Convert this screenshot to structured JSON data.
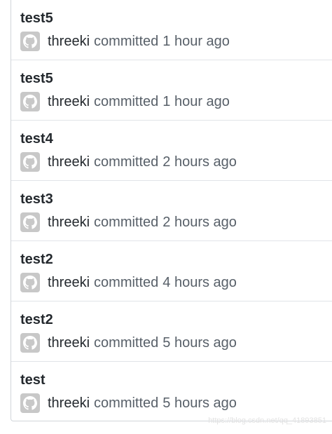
{
  "commits": [
    {
      "title": "test5",
      "author": "threeki",
      "action": "committed",
      "time": "1 hour ago"
    },
    {
      "title": "test5",
      "author": "threeki",
      "action": "committed",
      "time": "1 hour ago"
    },
    {
      "title": "test4",
      "author": "threeki",
      "action": "committed",
      "time": "2 hours ago"
    },
    {
      "title": "test3",
      "author": "threeki",
      "action": "committed",
      "time": "2 hours ago"
    },
    {
      "title": "test2",
      "author": "threeki",
      "action": "committed",
      "time": "4 hours ago"
    },
    {
      "title": "test2",
      "author": "threeki",
      "action": "committed",
      "time": "5 hours ago"
    },
    {
      "title": "test",
      "author": "threeki",
      "action": "committed",
      "time": "5 hours ago"
    }
  ],
  "avatar_icon": "github-octocat-icon",
  "watermark": "https://blog.csdn.net/qq_41893851",
  "colors": {
    "title": "#24292e",
    "meta": "#586069",
    "avatar_bg": "#c8c8c8",
    "border": "#e1e4e8"
  }
}
